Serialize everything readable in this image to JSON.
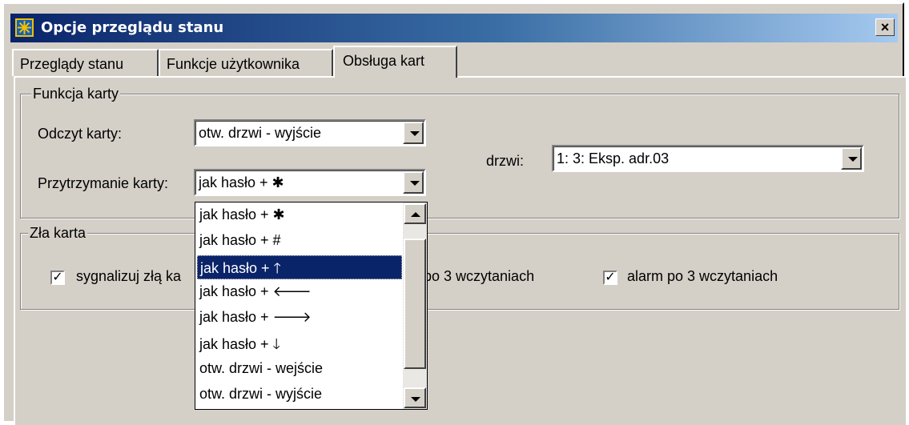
{
  "window": {
    "title": "Opcje przeglądu stanu",
    "close_label": "×",
    "icon": "app-star-icon"
  },
  "tabs": [
    {
      "label": "Przeglądy stanu",
      "active": false
    },
    {
      "label": "Funkcje użytkownika",
      "active": false
    },
    {
      "label": "Obsługa kart",
      "active": true
    }
  ],
  "card_function": {
    "group_title": "Funkcja karty",
    "read_label": "Odczyt karty:",
    "read_value": "otw. drzwi - wyjście",
    "hold_label": "Przytrzymanie karty:",
    "hold_value": "jak hasło + ✱",
    "door_label": "drzwi:",
    "door_value": "1: 3: Eksp. adr.03"
  },
  "bad_card": {
    "group_title": "Zła karta",
    "options": [
      {
        "label": "sygnalizuj złą ka",
        "checked": true
      },
      {
        "label": "po 3 wczytaniach",
        "checked": false
      },
      {
        "label": "alarm po 3 wczytaniach",
        "checked": true
      }
    ]
  },
  "dropdown": {
    "items": [
      "jak hasło + ✱",
      "jak hasło + #",
      "jak hasło + 🡑",
      "jak hasło + 🡐",
      "jak hasło + 🡒",
      "jak hasło + 🡓",
      "otw. drzwi - wejście",
      "otw. drzwi - wyjście"
    ],
    "selected_index": 2
  },
  "colors": {
    "titlebar_start": "#0a246a",
    "titlebar_end": "#a6caf0",
    "selection": "#0a246a",
    "face": "#d4d0c8"
  }
}
